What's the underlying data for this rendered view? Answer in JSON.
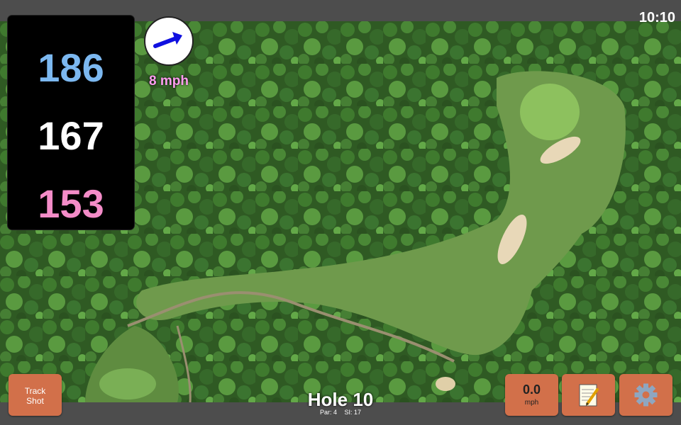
{
  "status_bar": {
    "time": "10:10"
  },
  "distances": {
    "back": "186",
    "middle": "167",
    "front": "153"
  },
  "wind": {
    "speed": "8 mph",
    "icon": "wind-arrow-icon"
  },
  "hole": {
    "title": "Hole 10",
    "par": "Par: 4",
    "stroke_index": "SI: 17"
  },
  "buttons": {
    "track_shot": "Track Shot",
    "speed_value": "0.0",
    "speed_unit": "mph",
    "notes_icon": "notepad-icon",
    "settings_icon": "gear-icon"
  },
  "colors": {
    "back_distance": "#7cb8f0",
    "middle_distance": "#ffffff",
    "front_distance": "#f48cc8",
    "wind_text": "#ff9df0",
    "button": "#d2704a"
  }
}
